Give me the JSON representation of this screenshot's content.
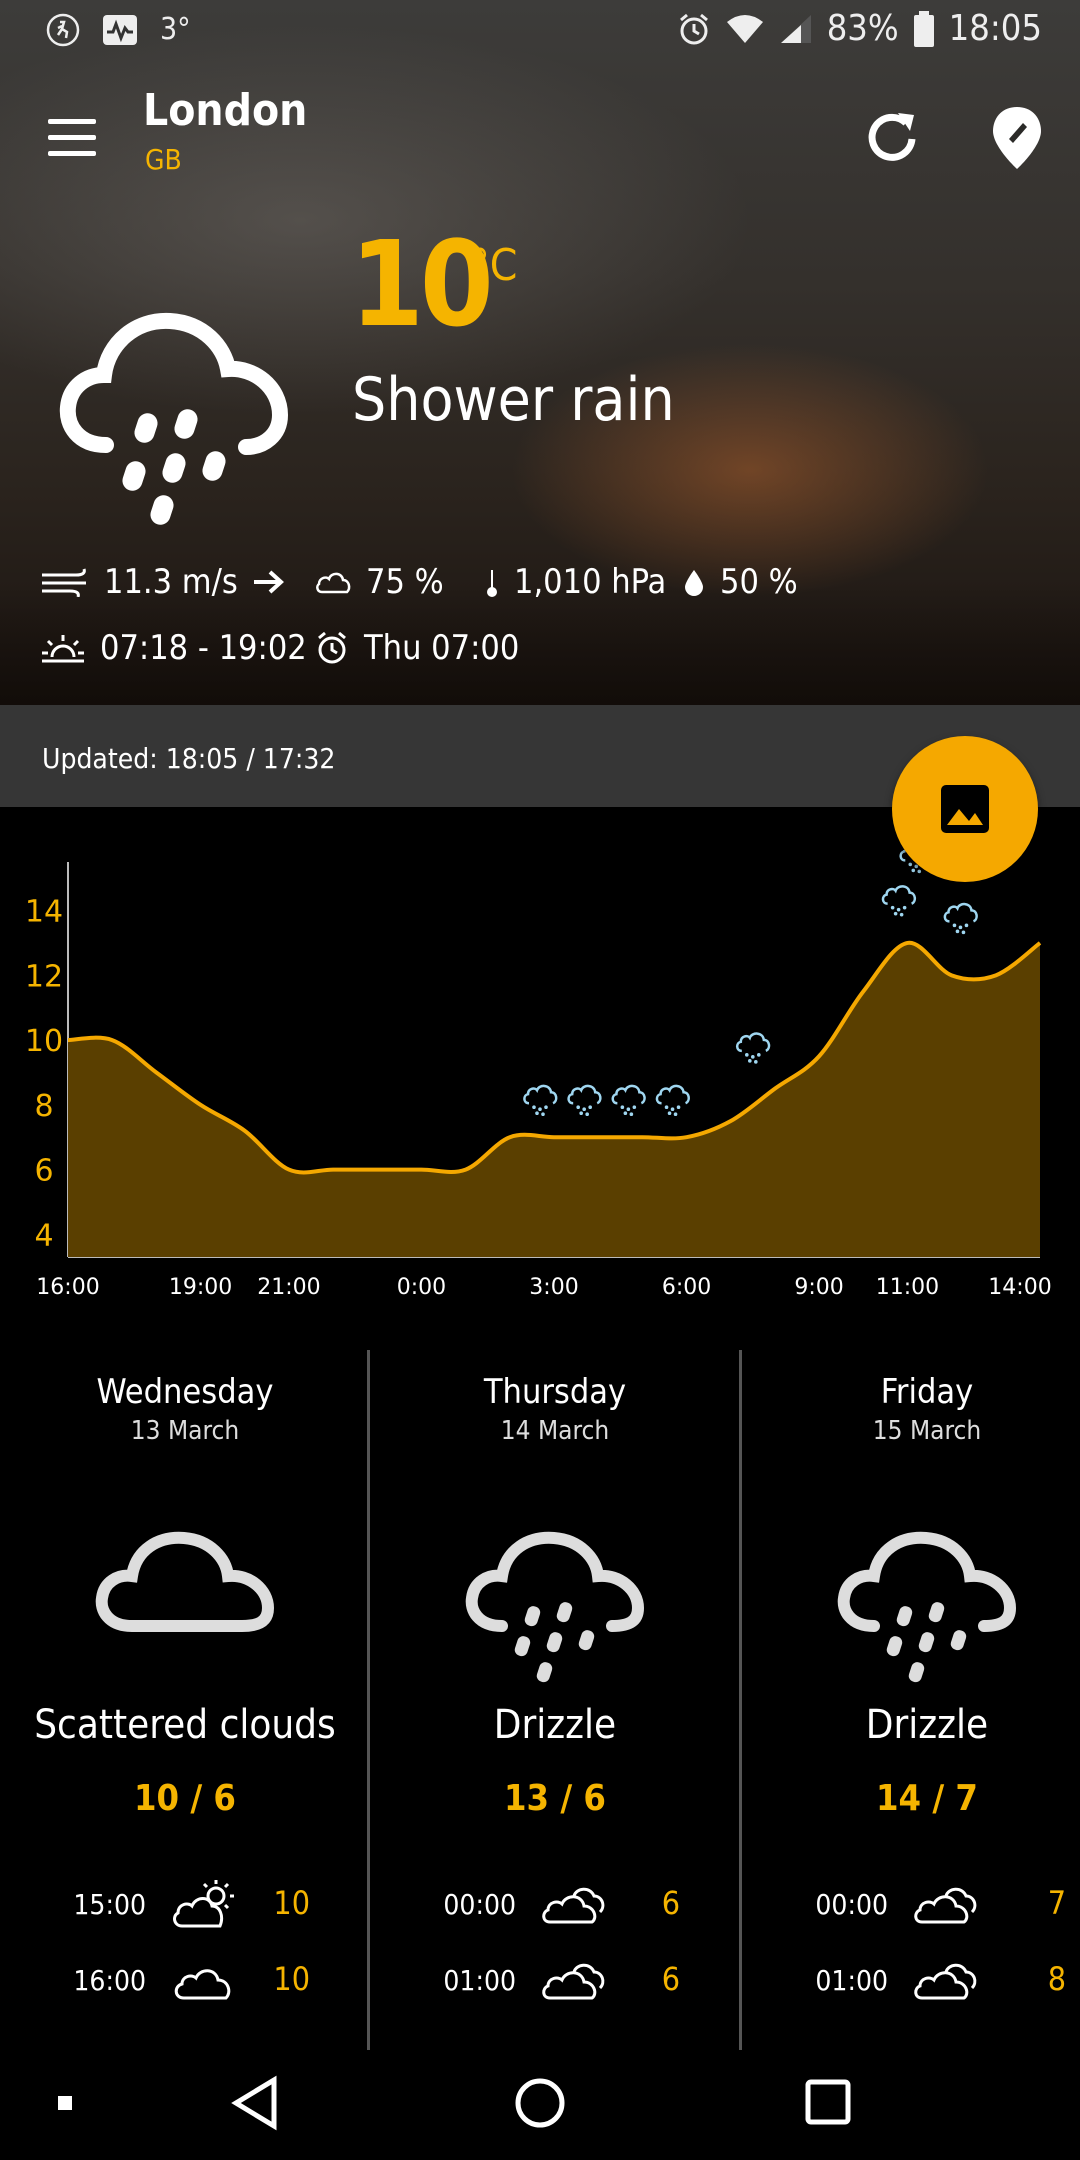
{
  "status_bar": {
    "temp": "3°",
    "battery": "83%",
    "time": "18:05"
  },
  "header": {
    "city": "London",
    "country": "GB"
  },
  "current": {
    "temperature": "10",
    "unit": "°C",
    "description": "Shower rain",
    "wind": "11.3 m/s",
    "clouds": "75 %",
    "pressure": "1,010 hPa",
    "humidity": "50 %",
    "sun": "07:18 - 19:02",
    "alarm": "Thu 07:00"
  },
  "updated": "Updated: 18:05 / 17:32",
  "chart_data": {
    "type": "area",
    "x": [
      "16:00",
      "17:00",
      "18:00",
      "19:00",
      "20:00",
      "21:00",
      "22:00",
      "23:00",
      "0:00",
      "1:00",
      "2:00",
      "3:00",
      "4:00",
      "5:00",
      "6:00",
      "7:00",
      "8:00",
      "9:00",
      "10:00",
      "11:00",
      "12:00",
      "13:00",
      "14:00"
    ],
    "x_ticks": [
      "16:00",
      "19:00",
      "21:00",
      "0:00",
      "3:00",
      "6:00",
      "9:00",
      "11:00",
      "14:00"
    ],
    "y": [
      10,
      10,
      9,
      8,
      7.2,
      6,
      6,
      6,
      6,
      6,
      7,
      7,
      7,
      7,
      7,
      7.5,
      8.5,
      9.5,
      11.5,
      13,
      12,
      12,
      13
    ],
    "ylim": [
      3.3,
      15.5
    ],
    "y_ticks": [
      4,
      6,
      8,
      10,
      12,
      14
    ],
    "color": "#f5a800",
    "fill": "#5a3f00"
  },
  "forecast": [
    {
      "day": "Wednesday",
      "date": "13 March",
      "condition": "Scattered clouds",
      "range": "10 / 6",
      "icon": "cloud",
      "hours": [
        {
          "time": "15:00",
          "icon": "sun-cloud",
          "temp": "10"
        },
        {
          "time": "16:00",
          "icon": "cloud",
          "temp": "10"
        }
      ]
    },
    {
      "day": "Thursday",
      "date": "14 March",
      "condition": "Drizzle",
      "range": "13 / 6",
      "icon": "rain-cloud",
      "hours": [
        {
          "time": "00:00",
          "icon": "clouds",
          "temp": "6"
        },
        {
          "time": "01:00",
          "icon": "clouds",
          "temp": "6"
        }
      ]
    },
    {
      "day": "Friday",
      "date": "15 March",
      "condition": "Drizzle",
      "range": "14 / 7",
      "icon": "rain-cloud",
      "hours": [
        {
          "time": "00:00",
          "icon": "clouds",
          "temp": "7"
        },
        {
          "time": "01:00",
          "icon": "clouds",
          "temp": "8"
        }
      ]
    }
  ],
  "colors": {
    "accent": "#f5b400",
    "background": "#000000",
    "updated_bar": "#363636"
  }
}
